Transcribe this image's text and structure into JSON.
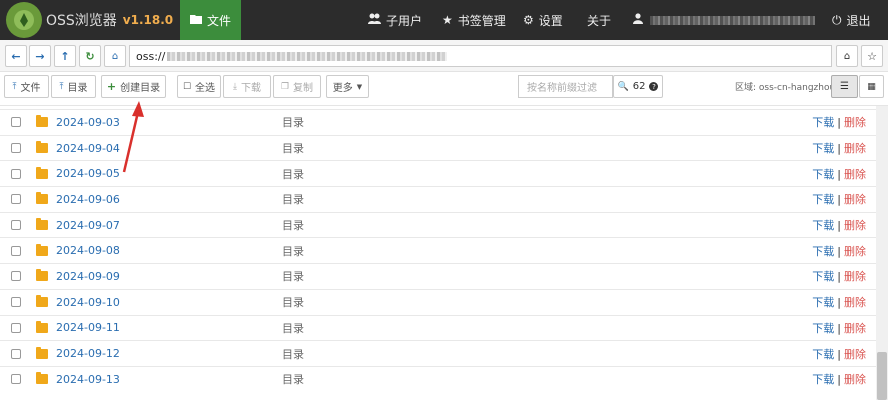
{
  "app": {
    "name": "OSS浏览器",
    "version": "v1.18.0"
  },
  "nav": {
    "file": "文件",
    "subuser": "子用户",
    "bookmarks": "书签管理",
    "settings": "设置",
    "about": "关于",
    "logout": "退出"
  },
  "address": {
    "prefix": "oss://"
  },
  "toolbar": {
    "upload_file": "文件",
    "upload_dir": "目录",
    "create_dir": "创建目录",
    "select_all": "全选",
    "download": "下载",
    "copy": "复制",
    "more": "更多",
    "search_placeholder": "按名称前缀过滤",
    "count": "62",
    "region": "区域: oss-cn-hangzhou"
  },
  "files": [
    {
      "name": "2024-09-03",
      "type": "目录"
    },
    {
      "name": "2024-09-04",
      "type": "目录"
    },
    {
      "name": "2024-09-05",
      "type": "目录"
    },
    {
      "name": "2024-09-06",
      "type": "目录"
    },
    {
      "name": "2024-09-07",
      "type": "目录"
    },
    {
      "name": "2024-09-08",
      "type": "目录"
    },
    {
      "name": "2024-09-09",
      "type": "目录"
    },
    {
      "name": "2024-09-10",
      "type": "目录"
    },
    {
      "name": "2024-09-11",
      "type": "目录"
    },
    {
      "name": "2024-09-12",
      "type": "目录"
    },
    {
      "name": "2024-09-13",
      "type": "目录"
    }
  ],
  "row_actions": {
    "download": "下载",
    "sep": "|",
    "delete": "删除"
  },
  "colors": {
    "navbar": "#2c2c2c",
    "active_tab": "#3c8d3c",
    "version": "#f0ad4e",
    "link": "#2a6db0",
    "delete": "#d9534f",
    "folder": "#f0a81a",
    "annotation_arrow": "#d9302c"
  },
  "icons": [
    "leaf-logo-icon",
    "folder-icon",
    "users-icon",
    "star-icon",
    "gear-icon",
    "user-icon",
    "power-icon",
    "arrow-left-icon",
    "arrow-right-icon",
    "arrow-up-icon",
    "refresh-icon",
    "home-icon",
    "star-outline-icon",
    "upload-icon",
    "plus-icon",
    "square-icon",
    "download-icon",
    "copy-icon",
    "caret-down-icon",
    "search-icon",
    "question-icon",
    "list-view-icon",
    "grid-view-icon"
  ]
}
